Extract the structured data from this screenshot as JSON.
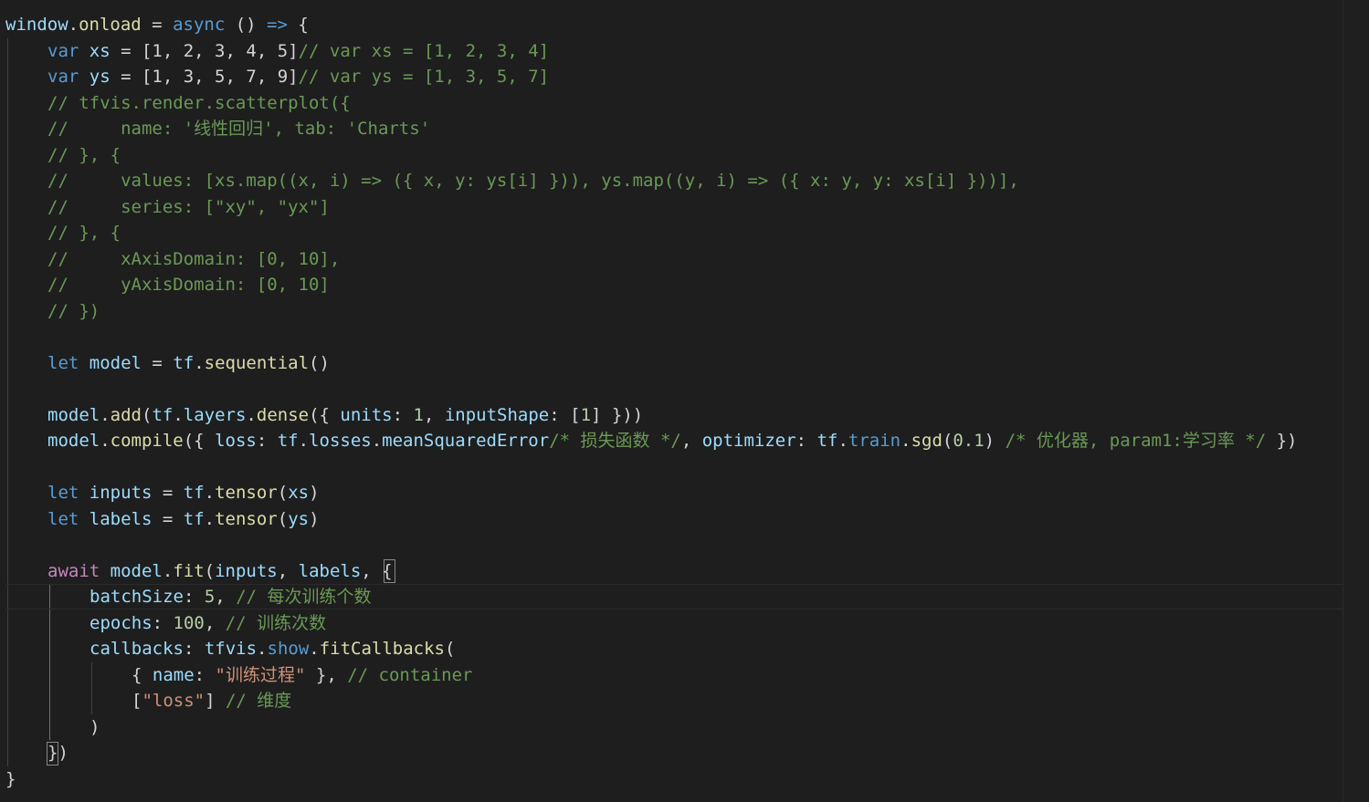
{
  "editor": {
    "lines": [
      {
        "indent": 0,
        "tokens": [
          [
            "var",
            "window"
          ],
          [
            "op",
            "."
          ],
          [
            "fn",
            "onload"
          ],
          [
            "op",
            " = "
          ],
          [
            "kw",
            "async"
          ],
          [
            "op",
            " () "
          ],
          [
            "kw",
            "=>"
          ],
          [
            "op",
            " {"
          ]
        ]
      },
      {
        "indent": 1,
        "tokens": [
          [
            "kw",
            "var"
          ],
          [
            "op",
            " "
          ],
          [
            "var",
            "xs"
          ],
          [
            "op",
            " = [1, 2, 3, 4, 5]"
          ],
          [
            "cm",
            "// var xs = [1, 2, 3, 4]"
          ]
        ]
      },
      {
        "indent": 1,
        "tokens": [
          [
            "kw",
            "var"
          ],
          [
            "op",
            " "
          ],
          [
            "var",
            "ys"
          ],
          [
            "op",
            " = [1, 3, 5, 7, 9]"
          ],
          [
            "cm",
            "// var ys = [1, 3, 5, 7]"
          ]
        ]
      },
      {
        "indent": 1,
        "tokens": [
          [
            "cm",
            "// tfvis.render.scatterplot({"
          ]
        ]
      },
      {
        "indent": 1,
        "tokens": [
          [
            "cm",
            "//     name: '线性回归', tab: 'Charts'"
          ]
        ]
      },
      {
        "indent": 1,
        "tokens": [
          [
            "cm",
            "// }, {"
          ]
        ]
      },
      {
        "indent": 1,
        "tokens": [
          [
            "cm",
            "//     values: [xs.map((x, i) => ({ x, y: ys[i] })), ys.map((y, i) => ({ x: y, y: xs[i] }))],"
          ]
        ]
      },
      {
        "indent": 1,
        "tokens": [
          [
            "cm",
            "//     series: [\"xy\", \"yx\"]"
          ]
        ]
      },
      {
        "indent": 1,
        "tokens": [
          [
            "cm",
            "// }, {"
          ]
        ]
      },
      {
        "indent": 1,
        "tokens": [
          [
            "cm",
            "//     xAxisDomain: [0, 10],"
          ]
        ]
      },
      {
        "indent": 1,
        "tokens": [
          [
            "cm",
            "//     yAxisDomain: [0, 10]"
          ]
        ]
      },
      {
        "indent": 1,
        "tokens": [
          [
            "cm",
            "// })"
          ]
        ]
      },
      {
        "indent": 1,
        "tokens": []
      },
      {
        "indent": 1,
        "tokens": [
          [
            "kw",
            "let"
          ],
          [
            "op",
            " "
          ],
          [
            "var",
            "model"
          ],
          [
            "op",
            " = "
          ],
          [
            "var",
            "tf"
          ],
          [
            "op",
            "."
          ],
          [
            "fn",
            "sequential"
          ],
          [
            "op",
            "()"
          ]
        ]
      },
      {
        "indent": 1,
        "tokens": []
      },
      {
        "indent": 1,
        "tokens": [
          [
            "var",
            "model"
          ],
          [
            "op",
            "."
          ],
          [
            "fn",
            "add"
          ],
          [
            "op",
            "("
          ],
          [
            "var",
            "tf"
          ],
          [
            "op",
            "."
          ],
          [
            "var",
            "layers"
          ],
          [
            "op",
            "."
          ],
          [
            "fn",
            "dense"
          ],
          [
            "op",
            "({ "
          ],
          [
            "var",
            "units"
          ],
          [
            "op",
            ": "
          ],
          [
            "num",
            "1"
          ],
          [
            "op",
            ", "
          ],
          [
            "var",
            "inputShape"
          ],
          [
            "op",
            ": ["
          ],
          [
            "num",
            "1"
          ],
          [
            "op",
            "] }))"
          ]
        ]
      },
      {
        "indent": 1,
        "tokens": [
          [
            "var",
            "model"
          ],
          [
            "op",
            "."
          ],
          [
            "fn",
            "compile"
          ],
          [
            "op",
            "({ "
          ],
          [
            "var",
            "loss"
          ],
          [
            "op",
            ": "
          ],
          [
            "var",
            "tf"
          ],
          [
            "op",
            "."
          ],
          [
            "var",
            "losses"
          ],
          [
            "op",
            "."
          ],
          [
            "var",
            "meanSquaredError"
          ],
          [
            "cm",
            "/* 损失函数 */"
          ],
          [
            "op",
            ", "
          ],
          [
            "var",
            "optimizer"
          ],
          [
            "op",
            ": "
          ],
          [
            "var",
            "tf"
          ],
          [
            "op",
            "."
          ],
          [
            "kw",
            "train"
          ],
          [
            "op",
            "."
          ],
          [
            "fn",
            "sgd"
          ],
          [
            "op",
            "("
          ],
          [
            "num",
            "0.1"
          ],
          [
            "op",
            ") "
          ],
          [
            "cm",
            "/* 优化器, param1:学习率 */"
          ],
          [
            "op",
            " })"
          ]
        ]
      },
      {
        "indent": 1,
        "tokens": []
      },
      {
        "indent": 1,
        "tokens": [
          [
            "kw",
            "let"
          ],
          [
            "op",
            " "
          ],
          [
            "var",
            "inputs"
          ],
          [
            "op",
            " = "
          ],
          [
            "var",
            "tf"
          ],
          [
            "op",
            "."
          ],
          [
            "fn",
            "tensor"
          ],
          [
            "op",
            "("
          ],
          [
            "var",
            "xs"
          ],
          [
            "op",
            ")"
          ]
        ]
      },
      {
        "indent": 1,
        "tokens": [
          [
            "kw",
            "let"
          ],
          [
            "op",
            " "
          ],
          [
            "var",
            "labels"
          ],
          [
            "op",
            " = "
          ],
          [
            "var",
            "tf"
          ],
          [
            "op",
            "."
          ],
          [
            "fn",
            "tensor"
          ],
          [
            "op",
            "("
          ],
          [
            "var",
            "ys"
          ],
          [
            "op",
            ")"
          ]
        ]
      },
      {
        "indent": 1,
        "tokens": []
      },
      {
        "indent": 1,
        "tokens": [
          [
            "ctrl",
            "await"
          ],
          [
            "op",
            " "
          ],
          [
            "var",
            "model"
          ],
          [
            "op",
            "."
          ],
          [
            "fn",
            "fit"
          ],
          [
            "op",
            "("
          ],
          [
            "var",
            "inputs"
          ],
          [
            "op",
            ", "
          ],
          [
            "var",
            "labels"
          ],
          [
            "op",
            ", {"
          ]
        ]
      },
      {
        "indent": 2,
        "tokens": [
          [
            "var",
            "batchSize"
          ],
          [
            "op",
            ": "
          ],
          [
            "num",
            "5"
          ],
          [
            "op",
            ", "
          ],
          [
            "cm",
            "// 每次训练个数"
          ]
        ]
      },
      {
        "indent": 2,
        "tokens": [
          [
            "var",
            "epochs"
          ],
          [
            "op",
            ": "
          ],
          [
            "num",
            "100"
          ],
          [
            "op",
            ", "
          ],
          [
            "cm",
            "// 训练次数"
          ]
        ]
      },
      {
        "indent": 2,
        "tokens": [
          [
            "var",
            "callbacks"
          ],
          [
            "op",
            ": "
          ],
          [
            "var",
            "tfvis"
          ],
          [
            "op",
            "."
          ],
          [
            "kw",
            "show"
          ],
          [
            "op",
            "."
          ],
          [
            "fn",
            "fitCallbacks"
          ],
          [
            "op",
            "("
          ]
        ]
      },
      {
        "indent": 3,
        "tokens": [
          [
            "op",
            "{ "
          ],
          [
            "var",
            "name"
          ],
          [
            "op",
            ": "
          ],
          [
            "str",
            "\"训练过程\""
          ],
          [
            "op",
            " }, "
          ],
          [
            "cm",
            "// container"
          ]
        ]
      },
      {
        "indent": 3,
        "tokens": [
          [
            "op",
            "["
          ],
          [
            "str",
            "\"loss\""
          ],
          [
            "op",
            "] "
          ],
          [
            "cm",
            "// 维度"
          ]
        ]
      },
      {
        "indent": 2,
        "tokens": [
          [
            "op",
            ")"
          ]
        ]
      },
      {
        "indent": 1,
        "tokens": [
          [
            "op",
            "})"
          ]
        ]
      },
      {
        "indent": 0,
        "tokens": [
          [
            "op",
            "}"
          ]
        ]
      }
    ]
  }
}
